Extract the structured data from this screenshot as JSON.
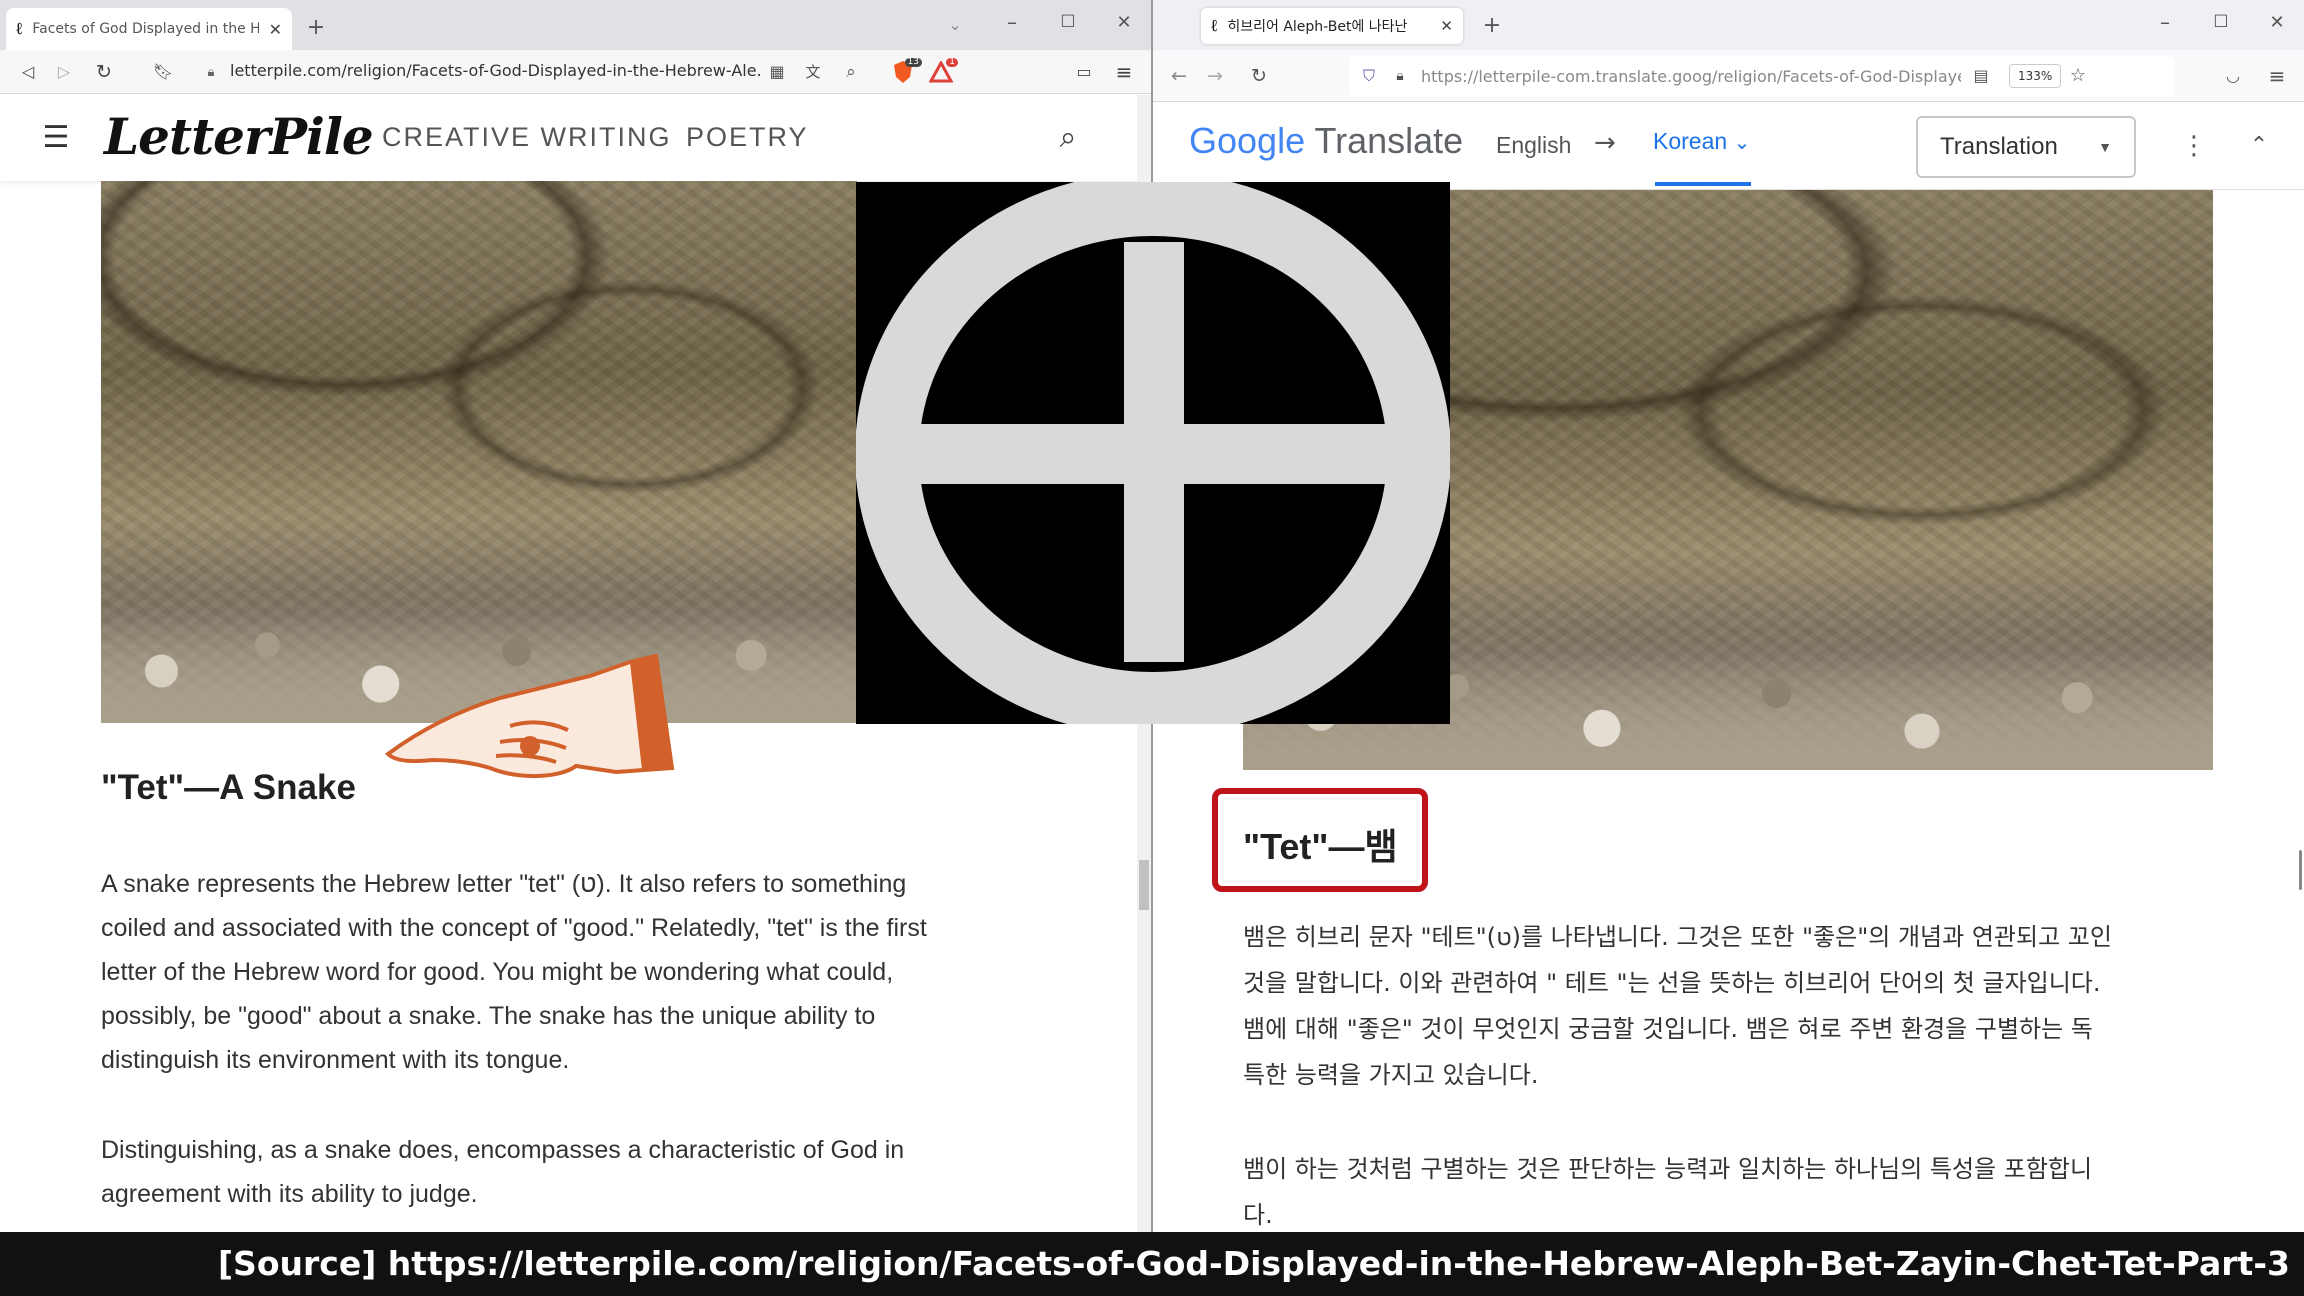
{
  "left_browser": {
    "tab_title": "Facets of God Displayed in the H",
    "url": "letterpile.com/religion/Facets-of-God-Displayed-in-the-Hebrew-Ale...",
    "badge_shield": "13",
    "badge_alert": "1",
    "site": {
      "logo": "LetterPile",
      "nav": [
        "CREATIVE WRITING",
        "POETRY"
      ]
    },
    "heading": "\"Tet\"—A Snake",
    "para1_lines": [
      "A snake represents the Hebrew letter \"tet\" (ט). It also refers to something",
      "coiled and associated with the concept of \"good.\" Relatedly, \"tet\" is the first",
      "letter of the Hebrew word for good. You might be wondering what could,",
      "possibly, be \"good\" about a snake. The snake has the unique ability to",
      "distinguish its environment with its tongue."
    ],
    "para2_lines": [
      "Distinguishing, as a snake does, encompasses a characteristic of God in",
      "agreement with its ability to judge."
    ]
  },
  "right_browser": {
    "tab_title": "히브리어 Aleph-Bet에 나타난",
    "url": "https://letterpile-com.translate.goog/religion/Facets-of-God-Displayed-in-th",
    "zoom": "133%",
    "translate_bar": {
      "brand_google": "Google",
      "brand_translate": "Translate",
      "from_lang": "English",
      "arrow": "→",
      "to_lang": "Korean",
      "mode": "Translation"
    },
    "heading": "\"Tet\"—뱀",
    "para1_lines": [
      "뱀은 히브리 문자 \"테트\"(ט)를 나타냅니다. 그것은 또한 \"좋은\"의 개념과 연관되고 꼬인",
      "것을 말합니다. 이와 관련하여 \" 테트 \"는 선을 뜻하는 히브리어 단어의 첫 글자입니다.",
      "뱀에 대해 \"좋은\" 것이 무엇인지 궁금할 것입니다. 뱀은 혀로 주변 환경을 구별하는 독",
      "특한 능력을 가지고 있습니다."
    ],
    "para2_lines": [
      "뱀이 하는 것처럼 구별하는 것은 판단하는 능력과 일치하는 하나님의 특성을 포함합니",
      "다."
    ]
  },
  "overlay_symbol": "tet-circle-cross",
  "source_caption": {
    "label": "[Source]",
    "url": "https://letterpile.com/religion/Facets-of-God-Displayed-in-the-Hebrew-Aleph-Bet-Zayin-Chet-Tet-Part-3"
  },
  "colors": {
    "highlight_box": "#c0141c",
    "hand": "#d2602a",
    "google_blue": "#1a73e8",
    "caption_bg": "#111111"
  }
}
